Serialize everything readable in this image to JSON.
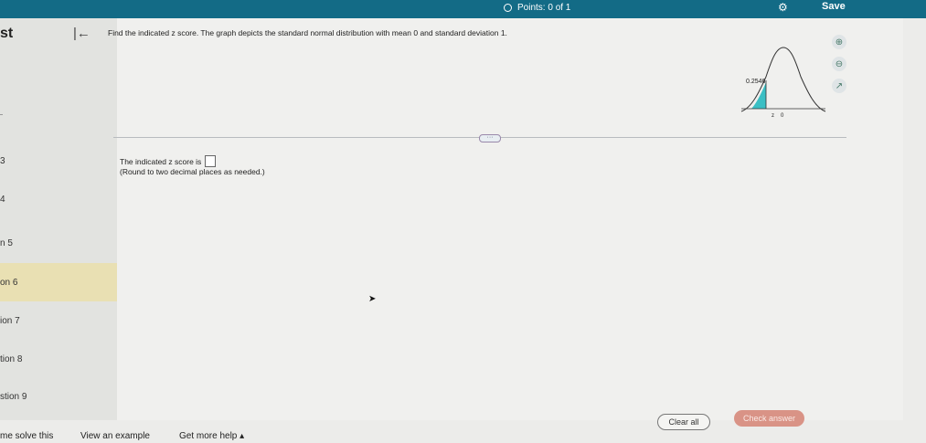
{
  "header": {
    "points": "Points: 0 of 1",
    "save_label": "Save"
  },
  "sidebar": {
    "title": "st",
    "items": [
      {
        "label": "3"
      },
      {
        "label": "4"
      },
      {
        "label": "n 5"
      },
      {
        "label": "on 6"
      },
      {
        "label": "ion 7"
      },
      {
        "label": "tion 8"
      },
      {
        "label": "stion 9"
      }
    ],
    "active_index": 3
  },
  "question": {
    "prompt": "Find the indicated z score. The graph depicts the standard normal distribution with mean 0 and standard deviation 1.",
    "graph_area_label": "0.2546",
    "graph_axis_z": "z",
    "graph_axis_zero": "0",
    "answer_prefix": "The indicated z score is",
    "answer_value": "",
    "hint": "(Round to two decimal places as needed.)"
  },
  "toolbar": {
    "more_dots": "···"
  },
  "footer": {
    "solve_label": "me solve this",
    "example_label": "View an example",
    "help_label": "Get more help",
    "clear_label": "Clear all",
    "check_label": "Check answer"
  },
  "colors": {
    "top_bar": "#136b86",
    "shaded_area": "#3bbfc4",
    "active_item": "#e9e0b3",
    "check_button": "#d99386"
  }
}
